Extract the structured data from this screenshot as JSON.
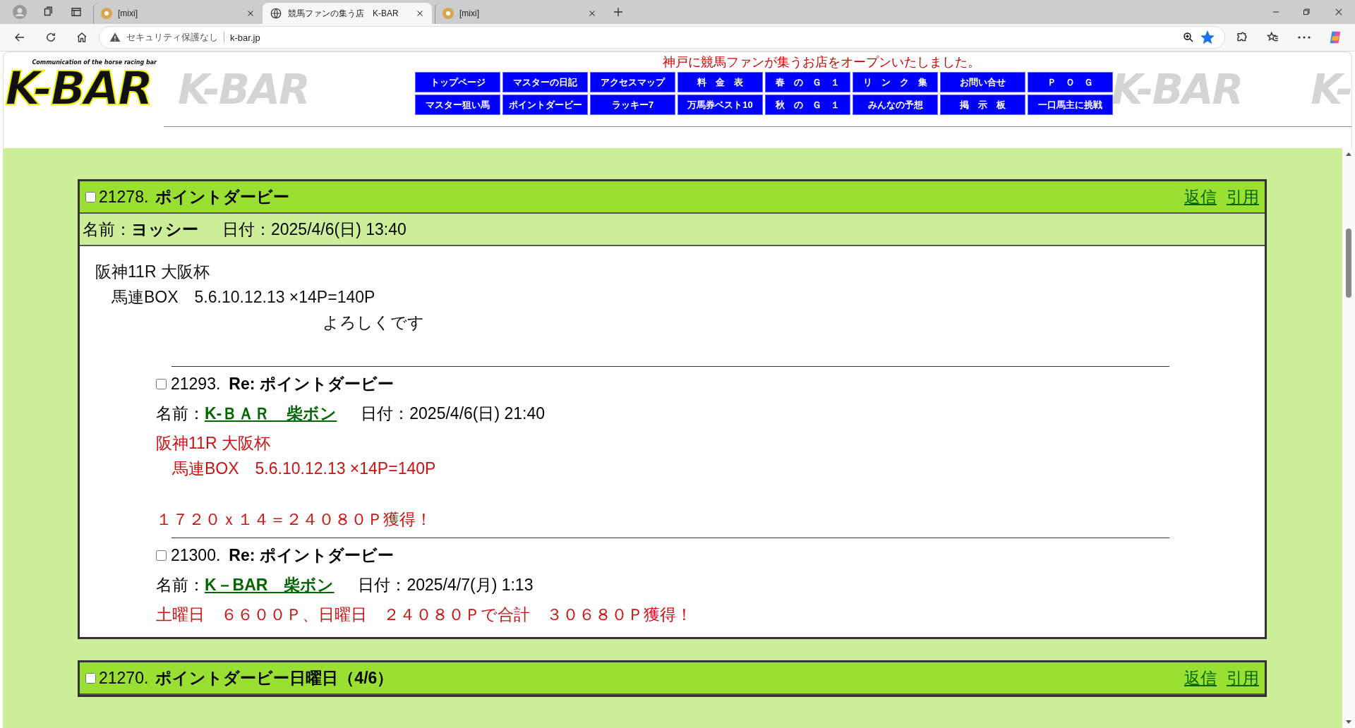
{
  "browser": {
    "tabs": [
      {
        "title": "[mixi]",
        "selected": false,
        "kind": "mixi"
      },
      {
        "title": "競馬ファンの集う店　K-BAR",
        "selected": true,
        "kind": "globe"
      },
      {
        "title": "[mixi]",
        "selected": false,
        "kind": "mixi"
      }
    ],
    "security_label": "セキュリティ保護なし",
    "url": "k-bar.jp",
    "favorite": true
  },
  "header": {
    "logo": "K-BAR",
    "logo_tagline": "Communication of the horse racing bar",
    "background_marks": [
      "K-BAR",
      "K-BAR",
      "K-"
    ],
    "announcement": "神戸に競馬ファンが集うお店をオープンいたしました。",
    "nav_rows": [
      [
        "トップページ",
        "マスターの日記",
        "アクセスマップ",
        "料　金　表",
        "春　の　Ｇ　１",
        "リ　ン　ク　集",
        "お問い合せ",
        "Ｐ　Ｏ　Ｇ"
      ],
      [
        "マスター狙い馬",
        "ポイントダービー",
        "ラッキー7",
        "万馬券ベスト10",
        "秋　の　Ｇ　１",
        "みんなの予想",
        "掲　示　板",
        "一口馬主に挑戦"
      ]
    ]
  },
  "posts": [
    {
      "checked": false,
      "number": "21278.",
      "title": "ポイントダービー",
      "actions": [
        "返信",
        "引用"
      ],
      "name_label": "名前：",
      "name": "ヨッシー",
      "name_link": false,
      "date_label": "日付：",
      "date": "2025/4/6(日) 13:40",
      "body": [
        [
          "阪神11R 大阪杯",
          "　馬連BOX　5.6.10.12.13 ×14P=140P",
          "　　　　　　　　　　　　　　よろしくです"
        ]
      ],
      "replies": [
        {
          "checked": false,
          "number": "21293.",
          "prefix": "Re:",
          "title": "ポイントダービー",
          "name_label": "名前：",
          "name": "K-ＢＡＲ　柴ボン",
          "name_link": true,
          "date_label": "日付：",
          "date": "2025/4/6(日) 21:40",
          "body": [
            [
              "阪神11R 大阪杯",
              "　馬連BOX　5.6.10.12.13 ×14P=140P"
            ],
            [
              "１７２０ｘ１４＝２４０８０Ｐ獲得！"
            ]
          ]
        },
        {
          "checked": false,
          "number": "21300.",
          "prefix": "Re:",
          "title": "ポイントダービー",
          "name_label": "名前：",
          "name": "K－BAR　柴ボン",
          "name_link": true,
          "date_label": "日付：",
          "date": "2025/4/7(月) 1:13",
          "body": [
            [
              "土曜日　６６００Ｐ、日曜日　２４０８０Ｐで合計　３０６８０Ｐ獲得！"
            ]
          ]
        }
      ]
    },
    {
      "checked": false,
      "number": "21270.",
      "title": "ポイントダービー日曜日（4/6）",
      "actions": [
        "返信",
        "引用"
      ]
    }
  ]
}
